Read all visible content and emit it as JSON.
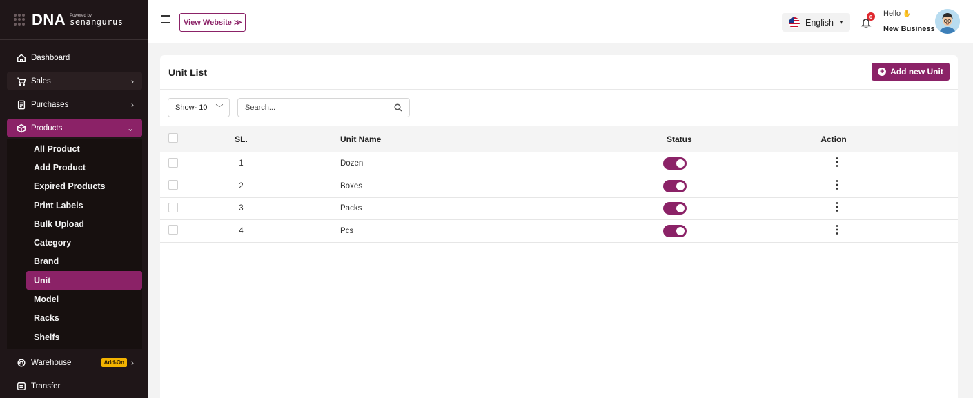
{
  "brand": {
    "name": "DNA",
    "powered": "Powered by",
    "company": "senangurus"
  },
  "sidebar": {
    "items": [
      {
        "label": "Dashboard",
        "icon": "home-icon"
      },
      {
        "label": "Sales",
        "icon": "cart-icon"
      },
      {
        "label": "Purchases",
        "icon": "receipt-icon"
      },
      {
        "label": "Products",
        "icon": "box-icon"
      }
    ],
    "products_sub": [
      "All Product",
      "Add Product",
      "Expired Products",
      "Print Labels",
      "Bulk Upload",
      "Category",
      "Brand",
      "Unit",
      "Model",
      "Racks",
      "Shelfs"
    ],
    "warehouse": {
      "label": "Warehouse",
      "badge": "Add-On"
    },
    "transfer": {
      "label": "Transfer"
    }
  },
  "header": {
    "view_website": "View Website ≫",
    "language": "English",
    "notifications": "6",
    "hello": "Hello",
    "business": "New Business"
  },
  "main": {
    "title": "Unit List",
    "add_button": "Add new Unit",
    "show": "Show- 10",
    "search_placeholder": "Search...",
    "columns": {
      "sl": "SL.",
      "name": "Unit Name",
      "status": "Status",
      "action": "Action"
    },
    "rows": [
      {
        "sl": "1",
        "name": "Dozen",
        "status": true
      },
      {
        "sl": "2",
        "name": "Boxes",
        "status": true
      },
      {
        "sl": "3",
        "name": "Packs",
        "status": true
      },
      {
        "sl": "4",
        "name": "Pcs",
        "status": true
      }
    ]
  },
  "colors": {
    "accent": "#8b2267",
    "sidebar_bg": "#1f1618",
    "addon": "#f2b300"
  }
}
